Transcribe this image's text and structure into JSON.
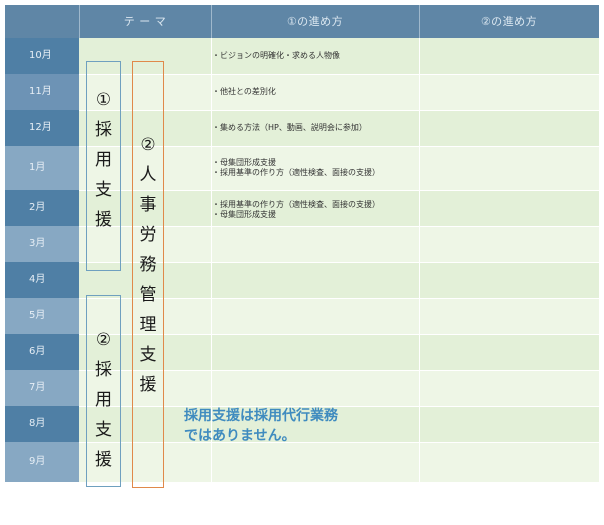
{
  "header": {
    "blank": "",
    "theme": "テ ー マ",
    "method1": "①の進め方",
    "method2": "②の進め方"
  },
  "months": [
    "10月",
    "11月",
    "12月",
    "1月",
    "2月",
    "3月",
    "4月",
    "5月",
    "6月",
    "7月",
    "8月",
    "9月"
  ],
  "notes": {
    "oct": "・ビジョンの明確化・求める人物像",
    "nov": "・他社との差別化",
    "dec": "・集める方法（HP、動画、説明会に参加）",
    "jan": "・母集団形成支援\n・採用基準の作り方（適性検査、面接の支援）",
    "feb": "・採用基準の作り方（適性検査、面接の支援）\n・母集団形成支援"
  },
  "theme_boxes": {
    "box1": [
      "①",
      "採",
      "用",
      "支",
      "援"
    ],
    "box2": [
      "②",
      "人",
      "事",
      "労",
      "務",
      "管",
      "理",
      "支",
      "援"
    ],
    "box3": [
      "②",
      "採",
      "用",
      "支",
      "援"
    ]
  },
  "callout": {
    "line1": "採用支援は採用代行業務",
    "line2": "ではありません。"
  },
  "colors": {
    "header_bg": "#5f86a6",
    "month_bg_dark": "#4f7fa5",
    "month_bg_light": "#87a8c3",
    "row_green_1": "#e3f0d8",
    "row_green_2": "#eef6e6",
    "box_blue": "#6fa0bf",
    "box_orange": "#e0894a",
    "callout_blue": "#3f8bbf"
  }
}
